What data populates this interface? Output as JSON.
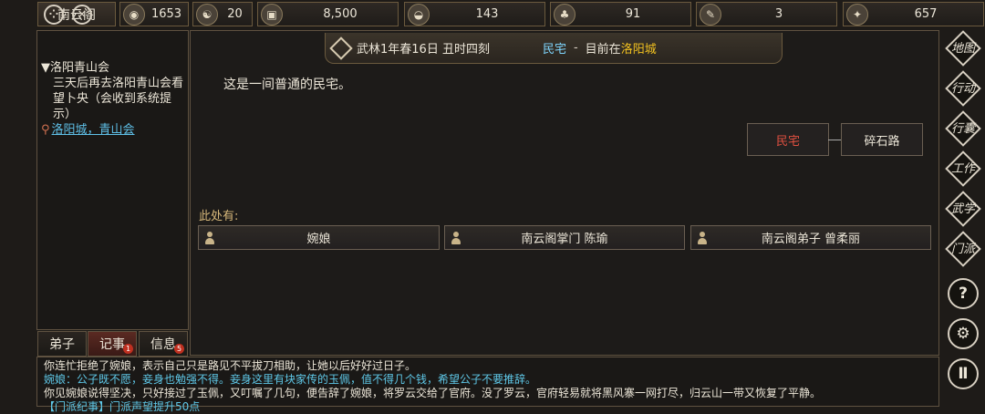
{
  "topbar": {
    "title": "南云阁",
    "stats": [
      {
        "icon": "coin-pouch-icon",
        "value": "1653"
      },
      {
        "icon": "yin-yang-icon",
        "value": "20"
      },
      {
        "icon": "copper-coin-icon",
        "value": "8,500"
      },
      {
        "icon": "food-bowl-icon",
        "value": "143"
      },
      {
        "icon": "herb-icon",
        "value": "91"
      },
      {
        "icon": "scroll-icon",
        "value": "3"
      },
      {
        "icon": "beast-icon",
        "value": "657"
      }
    ]
  },
  "quest": {
    "title": "▼洛阳青山会",
    "description": "三天后再去洛阳青山会看望卜央（会收到系统提示）",
    "location": "洛阳城，青山会"
  },
  "tabs": [
    {
      "label": "弟子",
      "badge": ""
    },
    {
      "label": "记事",
      "badge": "1"
    },
    {
      "label": "信息",
      "badge": "5"
    }
  ],
  "header": {
    "date": "武林1年春16日 丑时四刻",
    "place": "民宅",
    "separator": "-",
    "now_prefix": "目前在",
    "city": "洛阳城"
  },
  "scene": {
    "description": "这是一间普通的民宅。",
    "map_current": "民宅",
    "map_neighbor": "碎石路",
    "here_label": "此处有:",
    "npcs": [
      "婉娘",
      "南云阁掌门 陈瑜",
      "南云阁弟子 曾柔丽"
    ]
  },
  "right_nav": [
    "地图",
    "行动",
    "行囊",
    "工作",
    "武学",
    "门派"
  ],
  "right_round": [
    "?",
    "⚙",
    "Ⅱ"
  ],
  "log": [
    {
      "text": "你连忙拒绝了婉娘，表示自己只是路见不平拔刀相助，让她以后好好过日子。",
      "color": "#ece6d8"
    },
    {
      "text": "婉娘：公子既不愿，妾身也勉强不得。妾身这里有块家传的玉佩，值不得几个钱，希望公子不要推辞。",
      "color": "#5fc8e8"
    },
    {
      "text": "你见婉娘说得坚决，只好接过了玉佩，又叮嘱了几句，便告辞了婉娘，将罗云交给了官府。没了罗云，官府轻易就将黑风寨一网打尽，归云山一带又恢复了平静。",
      "color": "#ece6d8"
    },
    {
      "text": "【门派纪事】门派声望提升50点",
      "color": "#5fc8e8"
    }
  ],
  "colors": {
    "accent_gold": "#f0c020",
    "link_blue": "#5fc0e8",
    "current_red": "#e05040"
  }
}
